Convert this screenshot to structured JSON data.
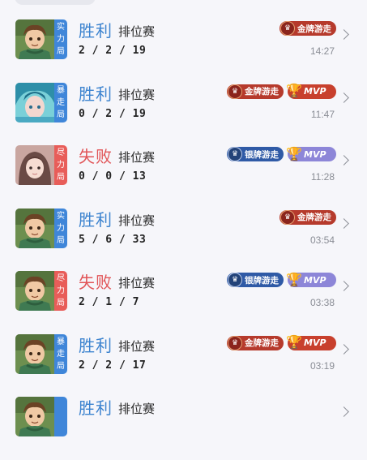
{
  "matches": [
    {
      "tag": "实力局",
      "tag_color": "blue",
      "result": "胜利",
      "result_type": "win",
      "mode": "排位赛",
      "kda": "2 / 2 / 19",
      "time": "14:27",
      "medal": "金牌游走",
      "medal_type": "gold",
      "mvp": null,
      "skin": "boy"
    },
    {
      "tag": "暴走局",
      "tag_color": "blue",
      "result": "胜利",
      "result_type": "win",
      "mode": "排位赛",
      "kda": "0 / 2 / 19",
      "time": "11:47",
      "medal": "金牌游走",
      "medal_type": "gold",
      "mvp": "MVP",
      "mvp_type": "gold",
      "skin": "teal"
    },
    {
      "tag": "尽力局",
      "tag_color": "red",
      "result": "失败",
      "result_type": "lose",
      "mode": "排位赛",
      "kda": "0 / 0 / 13",
      "time": "11:28",
      "medal": "银牌游走",
      "medal_type": "silver",
      "mvp": "MVP",
      "mvp_type": "silver",
      "skin": "girl"
    },
    {
      "tag": "实力局",
      "tag_color": "blue",
      "result": "胜利",
      "result_type": "win",
      "mode": "排位赛",
      "kda": "5 / 6 / 33",
      "time": "03:54",
      "medal": "金牌游走",
      "medal_type": "gold",
      "mvp": null,
      "skin": "boy"
    },
    {
      "tag": "尽力局",
      "tag_color": "red",
      "result": "失败",
      "result_type": "lose",
      "mode": "排位赛",
      "kda": "2 / 1 / 7",
      "time": "03:38",
      "medal": "银牌游走",
      "medal_type": "silver",
      "mvp": "MVP",
      "mvp_type": "silver",
      "skin": "boy"
    },
    {
      "tag": "暴走局",
      "tag_color": "blue",
      "result": "胜利",
      "result_type": "win",
      "mode": "排位赛",
      "kda": "2 / 2 / 17",
      "time": "03:19",
      "medal": "金牌游走",
      "medal_type": "gold",
      "mvp": "MVP",
      "mvp_type": "gold",
      "skin": "boy"
    },
    {
      "tag": "",
      "tag_color": "blue",
      "result": "胜利",
      "result_type": "win",
      "mode": "排位赛",
      "kda": "",
      "time": "",
      "medal": "",
      "medal_type": "gold",
      "mvp": null,
      "skin": "boy"
    }
  ],
  "colors": {
    "win": "#3c83cf",
    "lose": "#e15457",
    "tag_blue": "#3f86d9",
    "tag_red": "#e85d59"
  },
  "icons": {
    "medal": "crest-icon",
    "mvp": "trophy-icon",
    "row_arrow": "chevron-right-icon"
  }
}
